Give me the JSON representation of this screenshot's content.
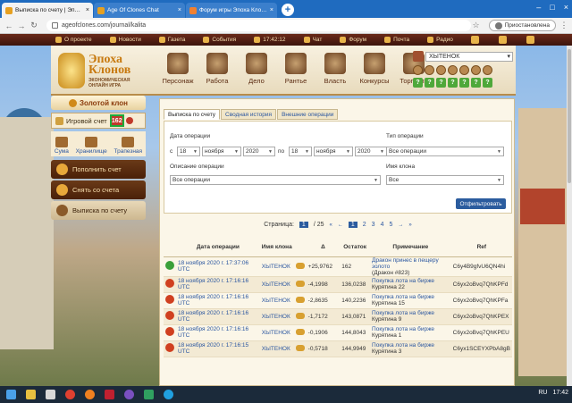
{
  "browser": {
    "tabs": [
      {
        "title": "Выписка по счету | Эпоха Клонов",
        "active": true
      },
      {
        "title": "Age Of Clones Chat",
        "active": false
      },
      {
        "title": "Форум игры Эпоха Клонов",
        "active": false
      }
    ],
    "url": "ageofclones.com/journal/kalita",
    "profile_label": "Приостановлена"
  },
  "gamebar": {
    "items": [
      "О проекте",
      "Новости",
      "Газета",
      "События",
      "17:42:12",
      "Чат",
      "Форум",
      "Почта",
      "Радио"
    ]
  },
  "logo": {
    "line1": "Эпоха",
    "line2": "Клонов",
    "sub1": "ЭКОНОМИЧЕСКАЯ",
    "sub2": "ОНЛАЙН ИГРА"
  },
  "nav": [
    "Персонаж",
    "Работа",
    "Дело",
    "Рантье",
    "Власть",
    "Конкурсы",
    "Торговля"
  ],
  "player": {
    "name": "ХЫТЕНОК",
    "badge": "?"
  },
  "left": {
    "clan": "Золотой клон",
    "account_label": "Игровой счет",
    "account_count": "162",
    "sub": [
      "Сума",
      "Хранилище",
      "Трапезная"
    ],
    "menu": [
      "Пополнить счет",
      "Снять со счета",
      "Выписка по счету"
    ]
  },
  "main": {
    "tabs": [
      "Выписка по счету",
      "Сводная история",
      "Внешние операции"
    ],
    "filter": {
      "date_label": "Дата операции",
      "from": "с",
      "to": "по",
      "from_day": "18",
      "from_month": "ноября",
      "from_year": "2020",
      "to_day": "18",
      "to_month": "ноября",
      "to_year": "2020",
      "type_label": "Тип операции",
      "type_value": "Все операции",
      "desc_label": "Описание операции",
      "desc_value": "Все операции",
      "clan_label": "Имя клона",
      "clan_value": "Все",
      "submit": "Отфильтровать"
    },
    "pager": {
      "label": "Страница:",
      "current": "1",
      "total": "/ 25",
      "pages": [
        "1",
        "2",
        "3",
        "4",
        "5"
      ]
    },
    "columns": [
      "Дата операции",
      "Имя клона",
      "Δ",
      "Остаток",
      "Примечание",
      "Ref"
    ],
    "rows": [
      {
        "dir": "in",
        "date": "18 ноября 2020 г. 17:37:06 UTC",
        "name": "ХЫТЕНОК",
        "delta": "+25,9762",
        "rest": "162",
        "note": "Дракон принес в пещеру золото",
        "note2": "(Дракон #823)",
        "ref": "C6y4B9gfvU6QN4hi"
      },
      {
        "dir": "out",
        "date": "18 ноября 2020 г. 17:16:16 UTC",
        "name": "ХЫТЕНОК",
        "delta": "-4,1998",
        "rest": "136,0238",
        "note": "Покупка лота на бирже",
        "note2": "Курятина 22",
        "ref": "C6yx2oBvq7QhKPFd"
      },
      {
        "dir": "out",
        "date": "18 ноября 2020 г. 17:16:16 UTC",
        "name": "ХЫТЕНОК",
        "delta": "-2,8635",
        "rest": "140,2236",
        "note": "Покупка лота на бирже",
        "note2": "Курятина 15",
        "ref": "C6yx2oBvq7QhKPFa"
      },
      {
        "dir": "out",
        "date": "18 ноября 2020 г. 17:16:16 UTC",
        "name": "ХЫТЕНОК",
        "delta": "-1,7172",
        "rest": "143,0871",
        "note": "Покупка лота на бирже",
        "note2": "Курятина 9",
        "ref": "C6yx2oBvq7QhKPEX"
      },
      {
        "dir": "out",
        "date": "18 ноября 2020 г. 17:16:16 UTC",
        "name": "ХЫТЕНОК",
        "delta": "-0,1906",
        "rest": "144,8043",
        "note": "Покупка лота на бирже",
        "note2": "Курятина 1",
        "ref": "C6yx2oBvq7QhKPEU"
      },
      {
        "dir": "out",
        "date": "18 ноября 2020 г. 17:16:15 UTC",
        "name": "ХЫТЕНОК",
        "delta": "-0,5718",
        "rest": "144,9949",
        "note": "Покупка лота на бирже",
        "note2": "Курятина 3",
        "ref": "C6yx1SCEYXPbA8gB"
      }
    ]
  },
  "taskbar": {
    "lang": "RU",
    "time": "17:42"
  }
}
